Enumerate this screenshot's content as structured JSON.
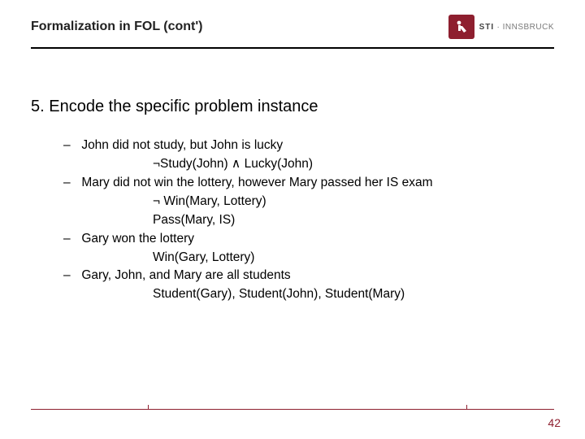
{
  "header": {
    "title": "Formalization in FOL (cont')",
    "logo": {
      "sti": "STI",
      "sep": " · ",
      "place": "INNSBRUCK"
    }
  },
  "step": {
    "num": "5.",
    "text": "Encode the specific problem instance"
  },
  "items": [
    {
      "text": "John did not study, but John is lucky",
      "formulas": [
        "¬Study(John)  ∧  Lucky(John)"
      ]
    },
    {
      "text": "Mary did not win the lottery, however Mary passed her IS exam",
      "formulas": [
        "¬ Win(Mary, Lottery)",
        "Pass(Mary, IS)"
      ]
    },
    {
      "text": "Gary won the lottery",
      "formulas": [
        "Win(Gary, Lottery)"
      ]
    },
    {
      "text": "Gary, John, and Mary are all students",
      "formulas": [
        "Student(Gary), Student(John), Student(Mary)"
      ]
    }
  ],
  "page": "42"
}
